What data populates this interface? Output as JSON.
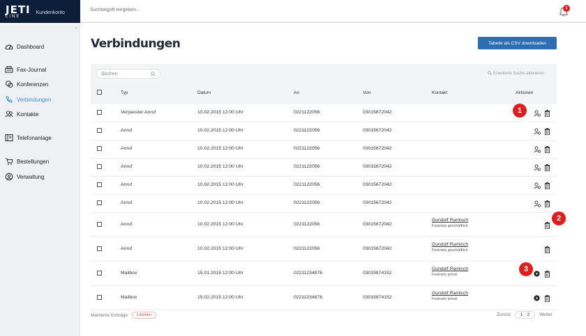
{
  "brand": {
    "logo_main": "JETI",
    "logo_sub": "LINE",
    "account_label": "Kundenkonto"
  },
  "topbar": {
    "search_placeholder": "Suchbegriff eingeben...",
    "notification_count": "1"
  },
  "sidebar": {
    "items": [
      {
        "label": "Dashboard",
        "icon": "dashboard-icon"
      },
      {
        "label": "Fax-Journal",
        "icon": "fax-icon"
      },
      {
        "label": "Konferenzen",
        "icon": "conference-icon"
      },
      {
        "label": "Verbindungen",
        "icon": "phone-icon"
      },
      {
        "label": "Kontakte",
        "icon": "contacts-icon"
      },
      {
        "label": "Telefonanlage",
        "icon": "phone-system-icon"
      },
      {
        "label": "Bestellungen",
        "icon": "cart-icon"
      },
      {
        "label": "Verwaltung",
        "icon": "settings-icon"
      }
    ]
  },
  "page": {
    "title": "Verbindungen",
    "csv_button": "Tabelle als CSV downloaden"
  },
  "table": {
    "search_placeholder": "Suchen",
    "advanced_search": "Erweiterte Suche aktivieren",
    "columns": {
      "typ": "Typ",
      "datum": "Datum",
      "an": "An",
      "von": "Von",
      "kontakt": "Kontakt",
      "aktionen": "Aktionen"
    },
    "rows": [
      {
        "typ": "Verpasster Anruf",
        "datum": "10.02.2015 12:00 Uhr",
        "an": "0221122056",
        "von": "03015672042",
        "kontakt_name": "",
        "kontakt_sub": "",
        "actions": [
          "add-contact",
          "delete"
        ]
      },
      {
        "typ": "Anruf",
        "datum": "10.02.2015 12:00 Uhr",
        "an": "0221122056",
        "von": "03015672042",
        "kontakt_name": "",
        "kontakt_sub": "",
        "actions": [
          "add-contact",
          "delete"
        ]
      },
      {
        "typ": "Anruf",
        "datum": "10.02.2015 12:00 Uhr",
        "an": "0221122056",
        "von": "03015672042",
        "kontakt_name": "",
        "kontakt_sub": "",
        "actions": [
          "add-contact",
          "delete"
        ]
      },
      {
        "typ": "Anruf",
        "datum": "10.02.2015 12:00 Uhr",
        "an": "0221122056",
        "von": "03015672042",
        "kontakt_name": "",
        "kontakt_sub": "",
        "actions": [
          "add-contact",
          "delete"
        ]
      },
      {
        "typ": "Anruf",
        "datum": "10.02.2015 12:00 Uhr",
        "an": "0221122056",
        "von": "03015672042",
        "kontakt_name": "",
        "kontakt_sub": "",
        "actions": [
          "add-contact",
          "delete"
        ]
      },
      {
        "typ": "Anruf",
        "datum": "10.02.2015 12:00 Uhr",
        "an": "0221122056",
        "von": "03015672042",
        "kontakt_name": "",
        "kontakt_sub": "",
        "actions": [
          "add-contact",
          "delete"
        ]
      },
      {
        "typ": "Anruf",
        "datum": "10.02.2015 12:00 Uhr",
        "an": "0221122056",
        "von": "03015672042",
        "kontakt_name": "Gundolf Ramisch",
        "kontakt_sub": "Festnetz geschäftlich",
        "actions": [
          "delete"
        ]
      },
      {
        "typ": "Anruf",
        "datum": "10.02.2015 12:00 Uhr",
        "an": "0221122056",
        "von": "03015672042",
        "kontakt_name": "Gundolf Ramisch",
        "kontakt_sub": "Festnetz geschäftlich",
        "actions": [
          "delete"
        ]
      },
      {
        "typ": "Mailbox",
        "datum": "15.01.2015 12:00 Uhr",
        "an": "02211234876",
        "von": "03015874152",
        "kontakt_name": "Gundolf Ramisch",
        "kontakt_sub": "Festnetz privat",
        "actions": [
          "play",
          "delete"
        ]
      },
      {
        "typ": "Mailbox",
        "datum": "15.02.2015 12:00 Uhr",
        "an": "02211234876",
        "von": "03015874152",
        "kontakt_name": "Gundolf Ramisch",
        "kontakt_sub": "Festnetz privat",
        "actions": [
          "play",
          "delete"
        ]
      }
    ]
  },
  "callouts": [
    "1",
    "2",
    "3"
  ],
  "footer": {
    "marked_label": "Markierte Einträge",
    "delete_label": "Löschen",
    "back_label": "Zurück",
    "page1": "1",
    "page2": "2",
    "next_label": "Weiter"
  },
  "colors": {
    "brand_bg": "#0d1e3a",
    "accent": "#3a8fd9",
    "button": "#2f6db1",
    "callout": "#e01e1e"
  }
}
